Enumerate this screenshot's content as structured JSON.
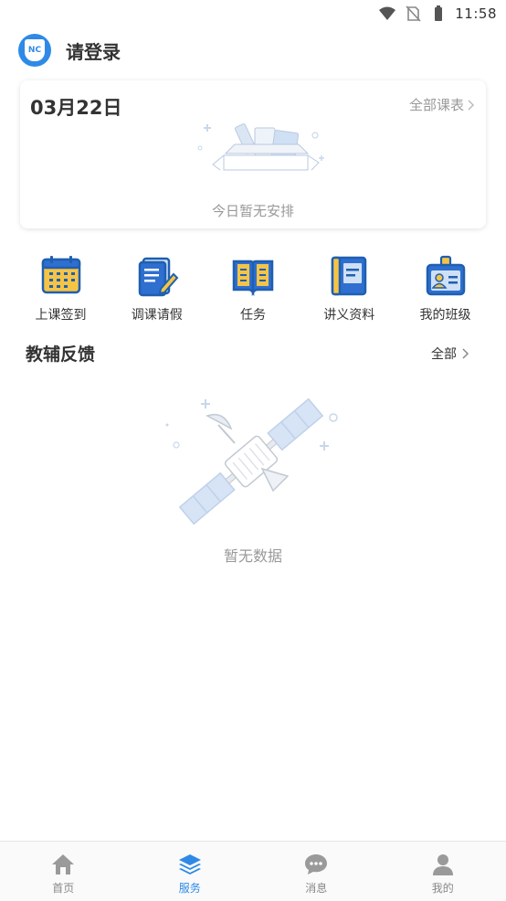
{
  "status_bar": {
    "time": "11:58",
    "icons": [
      "wifi-icon",
      "no-sim-icon",
      "battery-icon"
    ]
  },
  "header": {
    "logo_text": "NC",
    "title": "请登录"
  },
  "schedule_card": {
    "date": "03月22日",
    "all_schedule_link": "全部课表",
    "empty_text": "今日暂无安排",
    "illustration": "empty-box-icon"
  },
  "quick_menu": [
    {
      "label": "上课签到",
      "icon": "calendar-checkin-icon"
    },
    {
      "label": "调课请假",
      "icon": "leave-request-icon"
    },
    {
      "label": "任务",
      "icon": "book-task-icon"
    },
    {
      "label": "讲义资料",
      "icon": "handout-notebook-icon"
    },
    {
      "label": "我的班级",
      "icon": "class-badge-icon"
    }
  ],
  "feedback": {
    "title": "教辅反馈",
    "all_link": "全部",
    "empty_text": "暂无数据",
    "illustration": "satellite-icon"
  },
  "tabbar": [
    {
      "label": "首页",
      "icon": "home-icon",
      "active": false
    },
    {
      "label": "服务",
      "icon": "layers-icon",
      "active": true
    },
    {
      "label": "消息",
      "icon": "message-icon",
      "active": false
    },
    {
      "label": "我的",
      "icon": "profile-icon",
      "active": false
    }
  ],
  "colors": {
    "accent": "#2e8ae6",
    "muted": "#999999",
    "text": "#333333"
  }
}
